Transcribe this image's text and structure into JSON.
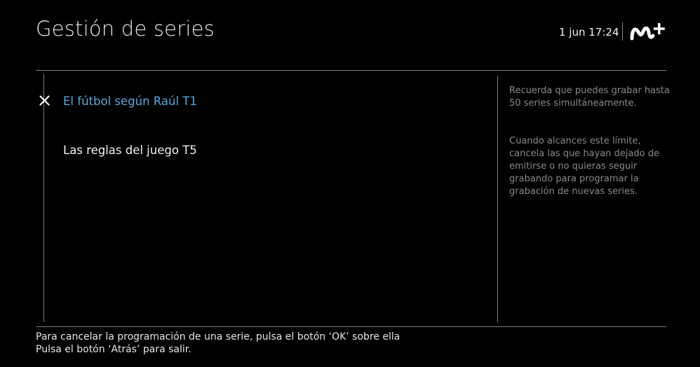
{
  "header": {
    "title": "Gestión de series",
    "datetime": "1 jun 17:24",
    "logo_icon": "movistar-plus-logo"
  },
  "series": [
    {
      "label": "El fútbol según Raúl T1",
      "selected": true,
      "icon": "cancel-x-icon"
    },
    {
      "label": "Las reglas del juego T5",
      "selected": false
    }
  ],
  "info": {
    "paragraph1": "Recuerda que puedes grabar hasta 50 series simultáneamente.",
    "paragraph2": "Cuando alcances este límite, cancela las que hayan dejado de emitirse o no quieras seguir grabando para programar la grabación de nuevas series."
  },
  "footer": {
    "line1": "Para cancelar la programación de una serie, pulsa el botón ‘OK’ sobre ella",
    "line2": "Pulsa el botón ‘Atrás’ para salir."
  },
  "colors": {
    "background": "#000000",
    "selected_text": "#5aa6dc",
    "info_text": "#8a8a8a",
    "rules": "#7a7a7a"
  }
}
